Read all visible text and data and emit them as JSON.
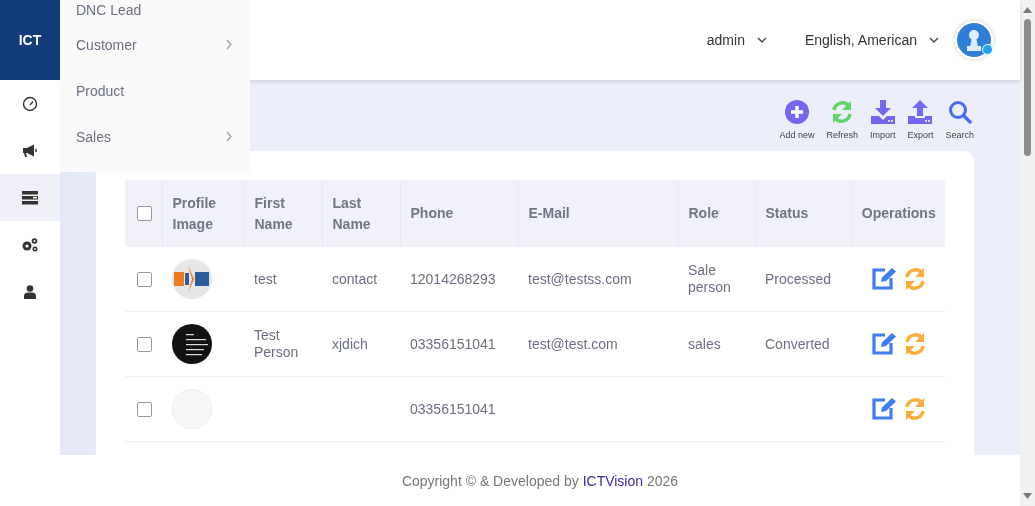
{
  "sidebar": {
    "logo": "ICT",
    "icons": [
      {
        "kind": "gauge",
        "selected": false
      },
      {
        "kind": "megaphone",
        "selected": false
      },
      {
        "kind": "list",
        "selected": true
      },
      {
        "kind": "gears",
        "selected": false
      },
      {
        "kind": "user",
        "selected": false
      }
    ]
  },
  "flyout": {
    "items": [
      {
        "label": "DNC Lead",
        "has_submenu": false
      },
      {
        "label": "Customer",
        "has_submenu": true
      },
      {
        "label": "Product",
        "has_submenu": false
      },
      {
        "label": "Sales",
        "has_submenu": true
      }
    ]
  },
  "header": {
    "user": "admin",
    "language": "English, American",
    "avatar_online": true
  },
  "toolbar": [
    {
      "kind": "add",
      "label": "Add new"
    },
    {
      "kind": "refresh",
      "label": "Refresh"
    },
    {
      "kind": "import",
      "label": "Import"
    },
    {
      "kind": "export",
      "label": "Export"
    },
    {
      "kind": "search",
      "label": "Search"
    }
  ],
  "table": {
    "select_all_checked": false,
    "columns": [
      "Profile Image",
      "First Name",
      "Last Name",
      "Phone",
      "E-Mail",
      "Role",
      "Status",
      "Operations"
    ],
    "rows": [
      {
        "checked": false,
        "kind": "logo",
        "first_name": "test",
        "last_name": "contact",
        "phone": "12014268293",
        "email": "test@testss.com",
        "role": "Sale person",
        "status": "Processed"
      },
      {
        "checked": false,
        "kind": "dark",
        "first_name": "Test Person",
        "last_name": "xjdich",
        "phone": "03356151041",
        "email": "test@test.com",
        "role": "sales",
        "status": "Converted"
      },
      {
        "checked": false,
        "kind": "none",
        "phone": "03356151041"
      }
    ]
  },
  "footer": {
    "before": "Copyright © & Developed by",
    "link": "ICTVision",
    "after": "2026"
  }
}
